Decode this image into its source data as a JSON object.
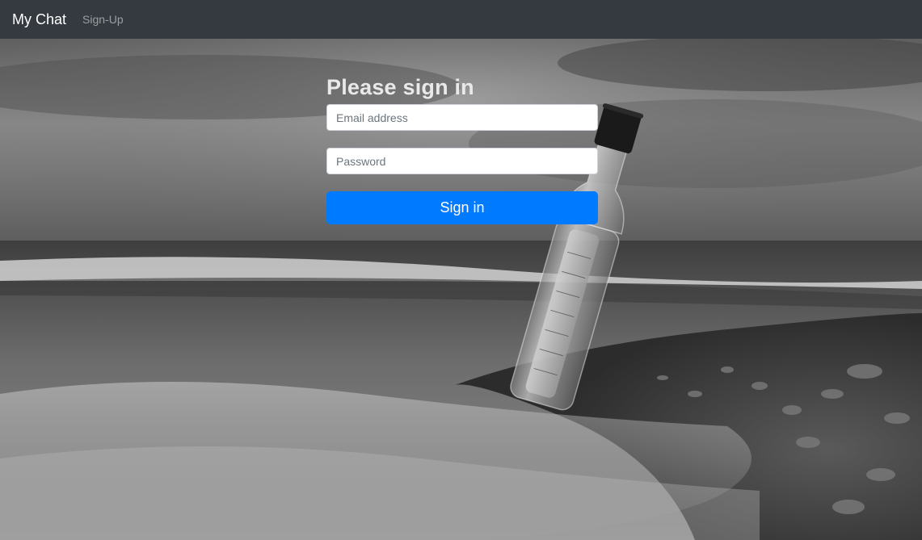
{
  "navbar": {
    "brand": "My Chat",
    "links": [
      {
        "label": "Sign-Up"
      }
    ]
  },
  "signin": {
    "heading": "Please sign in",
    "email_placeholder": "Email address",
    "email_value": "",
    "password_placeholder": "Password",
    "password_value": "",
    "submit_label": "Sign in"
  },
  "colors": {
    "navbar_bg": "#343a40",
    "primary": "#007bff",
    "background_tone": "grayscale"
  },
  "background": {
    "subject": "message-in-a-bottle-on-pebble-beach"
  }
}
